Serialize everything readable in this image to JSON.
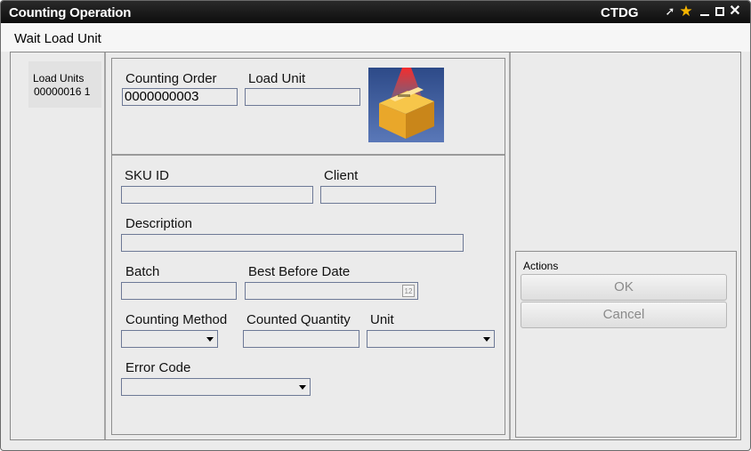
{
  "window": {
    "title": "Counting Operation",
    "app_code": "CTDG"
  },
  "titlebar_icons": [
    "pin-icon",
    "star-icon",
    "minimize-icon",
    "maximize-icon",
    "close-icon"
  ],
  "status": "Wait Load Unit",
  "load_units": {
    "header": "Load Units",
    "value": "00000016 1"
  },
  "form": {
    "counting_order": {
      "label": "Counting Order",
      "value": "0000000003"
    },
    "load_unit": {
      "label": "Load Unit",
      "value": ""
    },
    "sku_id": {
      "label": "SKU ID",
      "value": ""
    },
    "client": {
      "label": "Client",
      "value": ""
    },
    "description": {
      "label": "Description",
      "value": ""
    },
    "batch": {
      "label": "Batch",
      "value": ""
    },
    "best_before_date": {
      "label": "Best Before Date",
      "value": ""
    },
    "counting_method": {
      "label": "Counting Method",
      "value": ""
    },
    "counted_quantity": {
      "label": "Counted Quantity",
      "value": ""
    },
    "unit": {
      "label": "Unit",
      "value": ""
    },
    "error_code": {
      "label": "Error Code",
      "value": ""
    }
  },
  "actions": {
    "title": "Actions",
    "ok": "OK",
    "cancel": "Cancel"
  },
  "colors": {
    "titlebar": "#111111",
    "star": "#f5b400",
    "image_bg": "#3f5a95",
    "field_border": "#6d7996"
  }
}
